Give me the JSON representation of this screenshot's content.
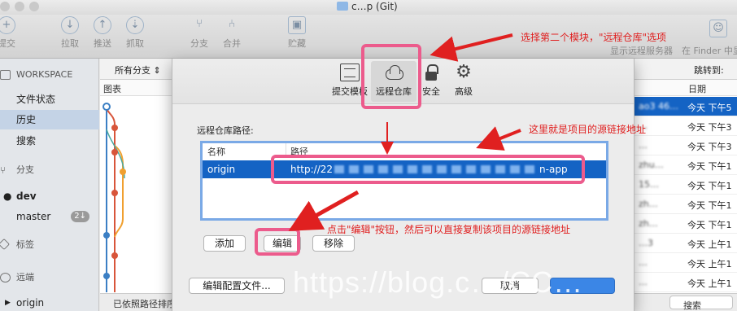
{
  "window": {
    "title": "c…p (Git)"
  },
  "toolbar": {
    "items": [
      {
        "label": "提交",
        "icon": "plus-icon"
      },
      {
        "label": "拉取",
        "icon": "arrow-down-icon"
      },
      {
        "label": "推送",
        "icon": "arrow-up-icon"
      },
      {
        "label": "抓取",
        "icon": "fetch-icon"
      },
      {
        "label": "分支",
        "icon": "branch-icon"
      },
      {
        "label": "合并",
        "icon": "merge-icon"
      },
      {
        "label": "贮藏",
        "icon": "stash-icon"
      }
    ],
    "show_remote_server": "显示远程服务器",
    "finder": "在 Finder 中显"
  },
  "sidebar": {
    "workspace": "WORKSPACE",
    "file_status": "文件状态",
    "history": "历史",
    "search": "搜索",
    "branches": "分支",
    "dev": "dev",
    "master": "master",
    "master_badge": "2↓",
    "tags": "标签",
    "remotes": "远端",
    "origin": "origin"
  },
  "history": {
    "branch_filter": "所有分支",
    "jump_to": "跳转到:",
    "col_graph": "图表",
    "col_date": "日期",
    "rows": [
      {
        "author": "ao3 46…",
        "date": "今天 下午5"
      },
      {
        "author": "…",
        "date": "今天 下午3"
      },
      {
        "author": "…",
        "date": "今天 下午3"
      },
      {
        "author": "zhu…",
        "date": "今天 下午1"
      },
      {
        "author": "15…",
        "date": "今天 下午1"
      },
      {
        "author": "zh…",
        "date": "今天 下午1"
      },
      {
        "author": "zh…",
        "date": "今天 下午1"
      },
      {
        "author": "…3",
        "date": "今天 上午1"
      },
      {
        "author": "…",
        "date": "今天 上午1"
      },
      {
        "author": "…",
        "date": "今天 上午1"
      }
    ],
    "status": "已依照路径排序",
    "search_placeholder": "搜索"
  },
  "modal": {
    "tabs": [
      {
        "label": "提交模板",
        "icon": "document-icon"
      },
      {
        "label": "远程仓库",
        "icon": "cloud-icon"
      },
      {
        "label": "安全",
        "icon": "lock-icon"
      },
      {
        "label": "高级",
        "icon": "gear-icon"
      }
    ],
    "remote_path_label": "远程仓库路径:",
    "col_name": "名称",
    "col_path": "路径",
    "remote_name": "origin",
    "remote_url_start": "http://22",
    "remote_url_end": "n-app",
    "add": "添加",
    "edit": "编辑",
    "remove": "移除",
    "edit_config": "编辑配置文件...",
    "cancel": "取消"
  },
  "annotations": {
    "select_tab": "选择第二个模块，\"远程仓库\"选项",
    "source_link": "这里就是项目的源链接地址",
    "click_edit": "点击\"编辑\"按钮，然后可以直接复制该项目的源链接地址"
  },
  "watermark": "https://blog.c…/CC…",
  "colors": {
    "highlight": "#ec5b8c",
    "annotation": "#e02020",
    "selection": "#1463c4"
  }
}
